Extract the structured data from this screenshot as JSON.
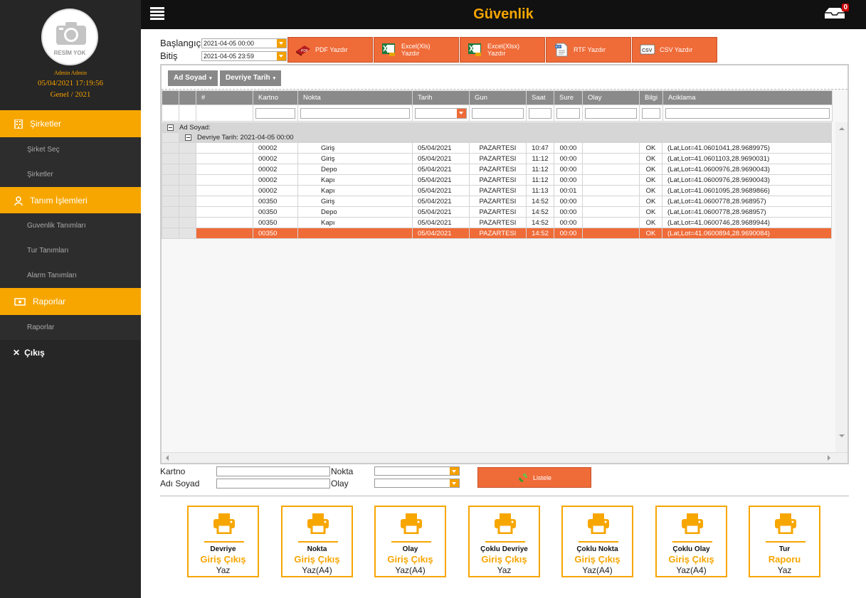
{
  "header": {
    "title": "Güvenlik",
    "notification_count": "0"
  },
  "profile": {
    "avatar_caption": "RESİM YOK",
    "name": "Admin Admin",
    "datetime": "05/04/2021 17:19:56",
    "period": "Genel / 2021"
  },
  "sidebar": {
    "sections": [
      {
        "label": "Şirketler",
        "icon": "building-icon",
        "items": [
          "Şirket Seç",
          "Şirketler"
        ]
      },
      {
        "label": "Tanım İşlemleri",
        "icon": "user-icon",
        "items": [
          "Guvenlik Tanımları",
          "Tur Tanımları",
          "Alarm Tanımları"
        ]
      },
      {
        "label": "Raporlar",
        "icon": "money-icon",
        "items": [
          "Raporlar"
        ]
      }
    ],
    "exit_label": "Çıkış"
  },
  "date_range": {
    "start_label": "Başlangıç",
    "start_value": "2021-04-05 00:00",
    "end_label": "Bitiş",
    "end_value": "2021-04-05 23:59"
  },
  "export_buttons": [
    {
      "label": "PDF Yazdır",
      "icon": "pdf-icon"
    },
    {
      "label": "Excel(Xls) Yazdır",
      "icon": "excel-icon"
    },
    {
      "label": "Excel(Xlsx) Yazdır",
      "icon": "excel-icon"
    },
    {
      "label": "RTF Yazdır",
      "icon": "rtf-icon"
    },
    {
      "label": "CSV Yazdır",
      "icon": "csv-icon"
    }
  ],
  "grid": {
    "group_chips": [
      "Ad Soyad",
      "Devriye Tarih"
    ],
    "columns": [
      "#",
      "Kartno",
      "Nokta",
      "Tarih",
      "Gun",
      "Saat",
      "Sure",
      "Olay",
      "Bilgi",
      "Aciklama"
    ],
    "group_level1": "Ad Soyad:",
    "group_level2": "Devriye Tarih: 2021-04-05 00:00",
    "rows": [
      {
        "kartno": "00002",
        "nokta": "Giriş",
        "tarih": "05/04/2021",
        "gun": "PAZARTESI",
        "saat": "10:47",
        "sure": "00:00",
        "olay": "",
        "bilgi": "OK",
        "aciklama": "(Lat,Lot=41.0601041,28.9689975)"
      },
      {
        "kartno": "00002",
        "nokta": "Giriş",
        "tarih": "05/04/2021",
        "gun": "PAZARTESI",
        "saat": "11:12",
        "sure": "00:00",
        "olay": "",
        "bilgi": "OK",
        "aciklama": "(Lat,Lot=41.0601103,28.9690031)"
      },
      {
        "kartno": "00002",
        "nokta": "Depo",
        "tarih": "05/04/2021",
        "gun": "PAZARTESI",
        "saat": "11:12",
        "sure": "00:00",
        "olay": "",
        "bilgi": "OK",
        "aciklama": "(Lat,Lot=41.0600976,28.9690043)"
      },
      {
        "kartno": "00002",
        "nokta": "Kapı",
        "tarih": "05/04/2021",
        "gun": "PAZARTESI",
        "saat": "11:12",
        "sure": "00:00",
        "olay": "",
        "bilgi": "OK",
        "aciklama": "(Lat,Lot=41.0600976,28.9690043)"
      },
      {
        "kartno": "00002",
        "nokta": "Kapı",
        "tarih": "05/04/2021",
        "gun": "PAZARTESI",
        "saat": "11:13",
        "sure": "00:01",
        "olay": "",
        "bilgi": "OK",
        "aciklama": "(Lat,Lot=41.0601095,28.9689866)"
      },
      {
        "kartno": "00350",
        "nokta": "Giriş",
        "tarih": "05/04/2021",
        "gun": "PAZARTESI",
        "saat": "14:52",
        "sure": "00:00",
        "olay": "",
        "bilgi": "OK",
        "aciklama": "(Lat,Lot=41.0600778,28.968957)"
      },
      {
        "kartno": "00350",
        "nokta": "Depo",
        "tarih": "05/04/2021",
        "gun": "PAZARTESI",
        "saat": "14:52",
        "sure": "00:00",
        "olay": "",
        "bilgi": "OK",
        "aciklama": "(Lat,Lot=41.0600778,28.968957)"
      },
      {
        "kartno": "00350",
        "nokta": "Kapı",
        "tarih": "05/04/2021",
        "gun": "PAZARTESI",
        "saat": "14:52",
        "sure": "00:00",
        "olay": "",
        "bilgi": "OK",
        "aciklama": "(Lat,Lot=41.0600746,28.9689944)"
      },
      {
        "kartno": "00350",
        "nokta": "",
        "tarih": "05/04/2021",
        "gun": "PAZARTESI",
        "saat": "14:52",
        "sure": "00:00",
        "olay": "",
        "bilgi": "OK",
        "aciklama": "(Lat,Lot=41.0600894,28.9690084)",
        "selected": true
      }
    ]
  },
  "filters": {
    "kartno_label": "Kartno",
    "kartno_value": "",
    "adsoyad_label": "Adı Soyad",
    "adsoyad_value": "",
    "nokta_label": "Nokta",
    "nokta_value": "",
    "olay_label": "Olay",
    "olay_value": "",
    "list_button": "Listele"
  },
  "report_cards": [
    {
      "line1": "Devriye",
      "line2": "Giriş Çıkış",
      "line3": "Yaz"
    },
    {
      "line1": "Nokta",
      "line2": "Giriş Çıkış",
      "line3": "Yaz(A4)"
    },
    {
      "line1": "Olay",
      "line2": "Giriş Çıkış",
      "line3": "Yaz(A4)"
    },
    {
      "line1": "Çoklu Devriye",
      "line2": "Giriş Çıkış",
      "line3": "Yaz"
    },
    {
      "line1": "Çoklu Nokta",
      "line2": "Giriş Çıkış",
      "line3": "Yaz(A4)"
    },
    {
      "line1": "Çoklu Olay",
      "line2": "Giriş Çıkış",
      "line3": "Yaz(A4)"
    },
    {
      "line1": "Tur",
      "line2": "Raporu",
      "line3": "Yaz"
    }
  ],
  "colors": {
    "accent": "#f7a600",
    "button": "#ef6b38",
    "sidebar": "#262626",
    "header": "#111111"
  }
}
